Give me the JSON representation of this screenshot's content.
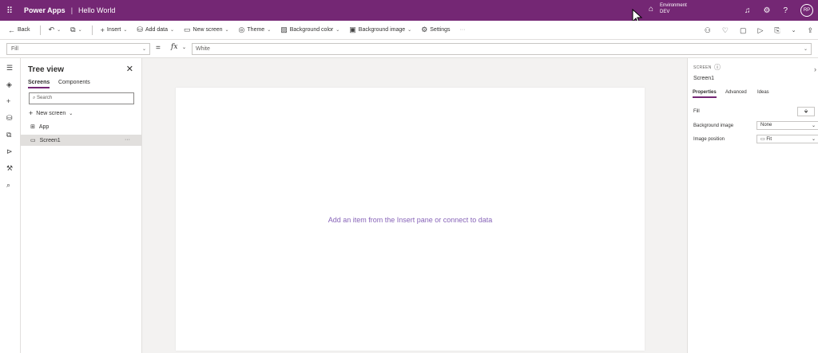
{
  "topbar": {
    "app_name": "Power Apps",
    "separator": "|",
    "doc_name": "Hello World",
    "env_label": "Environment",
    "env_value": "DEV",
    "avatar": "RP"
  },
  "commands": {
    "back": "Back",
    "insert": "Insert",
    "add_data": "Add data",
    "new_screen": "New screen",
    "theme": "Theme",
    "background_color": "Background color",
    "background_image": "Background image",
    "settings": "Settings",
    "more": "···"
  },
  "formula": {
    "property": "Fill",
    "equals": "=",
    "fx": "fx",
    "value": "White"
  },
  "tree": {
    "title": "Tree view",
    "tabs": [
      "Screens",
      "Components"
    ],
    "search_placeholder": "Search",
    "new_screen": "New screen",
    "items": [
      "App",
      "Screen1"
    ],
    "more": "···"
  },
  "canvas": {
    "placeholder": "Add an item from the Insert pane or connect to data"
  },
  "properties": {
    "type": "SCREEN",
    "name": "Screen1",
    "tabs": [
      "Properties",
      "Advanced",
      "Ideas"
    ],
    "fill_label": "Fill",
    "background_image_label": "Background image",
    "background_image_value": "None",
    "image_position_label": "Image position",
    "image_position_value": "Fit"
  },
  "colors": {
    "brand": "#742774",
    "placeholder": "#8764b8"
  }
}
